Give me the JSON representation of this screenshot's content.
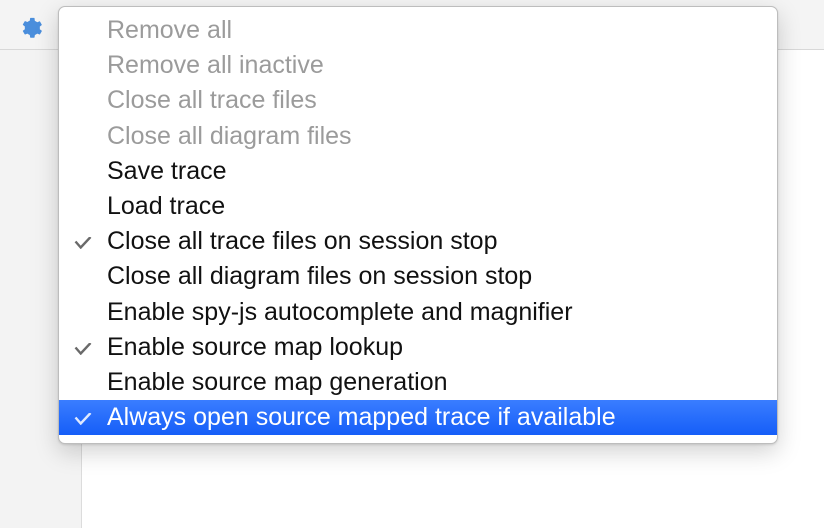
{
  "menu": {
    "items": [
      {
        "label": "Remove all",
        "disabled": true,
        "checked": false,
        "selected": false
      },
      {
        "label": "Remove all inactive",
        "disabled": true,
        "checked": false,
        "selected": false
      },
      {
        "label": "Close all trace files",
        "disabled": true,
        "checked": false,
        "selected": false
      },
      {
        "label": "Close all diagram files",
        "disabled": true,
        "checked": false,
        "selected": false
      },
      {
        "label": "Save trace",
        "disabled": false,
        "checked": false,
        "selected": false
      },
      {
        "label": "Load trace",
        "disabled": false,
        "checked": false,
        "selected": false
      },
      {
        "label": "Close all trace files on session stop",
        "disabled": false,
        "checked": true,
        "selected": false
      },
      {
        "label": "Close all diagram files on session stop",
        "disabled": false,
        "checked": false,
        "selected": false
      },
      {
        "label": "Enable spy-js autocomplete and magnifier",
        "disabled": false,
        "checked": false,
        "selected": false
      },
      {
        "label": "Enable source map lookup",
        "disabled": false,
        "checked": true,
        "selected": false
      },
      {
        "label": "Enable source map generation",
        "disabled": false,
        "checked": false,
        "selected": false
      },
      {
        "label": "Always open source mapped trace if available",
        "disabled": false,
        "checked": true,
        "selected": true
      }
    ]
  }
}
